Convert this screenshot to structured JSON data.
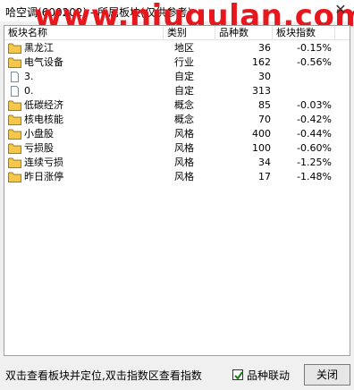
{
  "window": {
    "title": "哈空调(600202) - 所属板块(仅供参考)",
    "close_glyph": "✕",
    "watermark": "www.niugulan.com"
  },
  "list": {
    "headers": {
      "name": "板块名称",
      "category": "类别",
      "count": "品种数",
      "index": "板块指数"
    },
    "rows": [
      {
        "icon": "folder-icon",
        "name": "黑龙江",
        "category": "地区",
        "count": "36",
        "index": "-0.15%"
      },
      {
        "icon": "folder-icon",
        "name": "电气设备",
        "category": "行业",
        "count": "162",
        "index": "-0.56%"
      },
      {
        "icon": "document-icon",
        "name": "3.",
        "category": "自定",
        "count": "30",
        "index": ""
      },
      {
        "icon": "document-icon",
        "name": "0.",
        "category": "自定",
        "count": "313",
        "index": ""
      },
      {
        "icon": "folder-icon",
        "name": "低碳经济",
        "category": "概念",
        "count": "85",
        "index": "-0.03%"
      },
      {
        "icon": "folder-icon",
        "name": "核电核能",
        "category": "概念",
        "count": "70",
        "index": "-0.42%"
      },
      {
        "icon": "folder-icon",
        "name": "小盘股",
        "category": "风格",
        "count": "400",
        "index": "-0.44%"
      },
      {
        "icon": "folder-icon",
        "name": "亏损股",
        "category": "风格",
        "count": "100",
        "index": "-0.60%"
      },
      {
        "icon": "folder-icon",
        "name": "连续亏损",
        "category": "风格",
        "count": "34",
        "index": "-1.25%"
      },
      {
        "icon": "folder-icon",
        "name": "昨日涨停",
        "category": "风格",
        "count": "17",
        "index": "-1.48%"
      }
    ]
  },
  "status": {
    "hint": "双击查看板块并定位,双击指数区查看指数",
    "linkage_label": "品种联动",
    "linkage_checked": true,
    "close_button": "关闭"
  },
  "colors": {
    "watermark": "#e8171d",
    "folder": "#f4c64a"
  }
}
